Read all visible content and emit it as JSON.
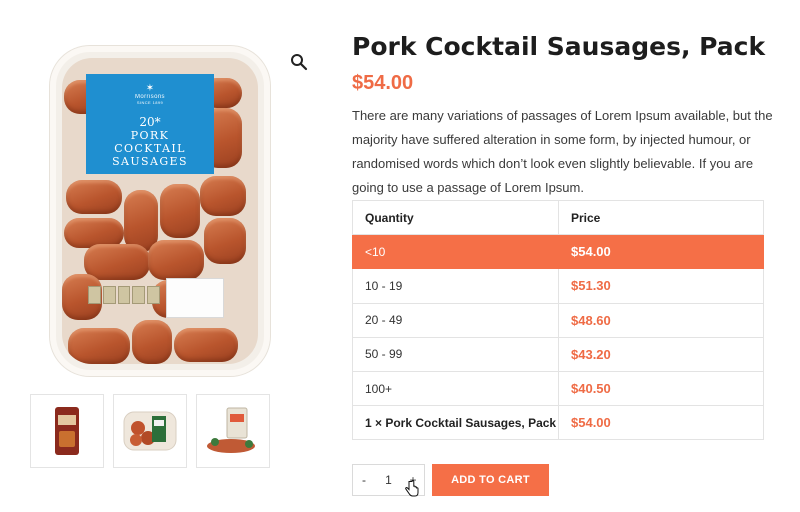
{
  "product": {
    "title": "Pork Cocktail Sausages, Pack",
    "price": "$54.00",
    "description": "There are many variations of passages of Lorem Ipsum available, but the majority have suffered alteration in some form, by injected humour, or randomised words which don’t look even slightly believable. If you are going to use a passage of Lorem Ipsum."
  },
  "packaging": {
    "brand": "Morrisons",
    "brand_sub": "SINCE 1899",
    "percent": "20*",
    "name_lines": [
      "PORK",
      "COCKTAIL",
      "SAUSAGES"
    ]
  },
  "gallery": {
    "zoom_icon": "search-icon",
    "thumbnails": [
      "thumbnail-bag",
      "thumbnail-tray",
      "thumbnail-plated"
    ]
  },
  "pricing_table": {
    "headers": [
      "Quantity",
      "Price"
    ],
    "rows": [
      {
        "qty": "<10",
        "price": "$54.00",
        "active": true
      },
      {
        "qty": "10 - 19",
        "price": "$51.30"
      },
      {
        "qty": "20 - 49",
        "price": "$48.60"
      },
      {
        "qty": "50 - 99",
        "price": "$43.20"
      },
      {
        "qty": "100+",
        "price": "$40.50"
      }
    ],
    "summary": {
      "qty": "1 × Pork Cocktail Sausages, Pack",
      "price": "$54.00"
    }
  },
  "cart": {
    "minus": "-",
    "quantity": "1",
    "plus": "+",
    "add_label": "ADD TO CART"
  },
  "colors": {
    "accent": "#f56f47",
    "price": "#ef6b45",
    "label_blue": "#1f8fd0"
  }
}
